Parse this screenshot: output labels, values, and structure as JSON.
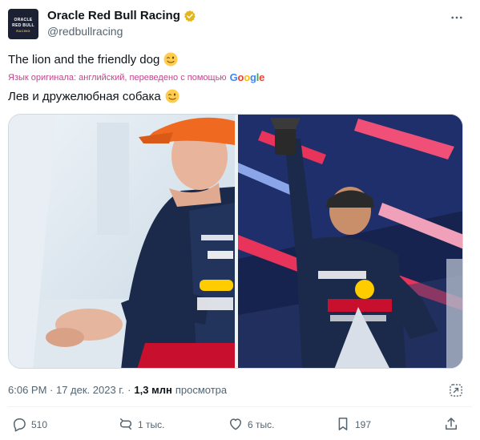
{
  "tweet": {
    "author": {
      "display_name": "Oracle Red Bull Racing",
      "handle": "@redbullracing",
      "verified_color": "#e2b719",
      "avatar_lines": [
        "ORACLE",
        "RED BULL",
        "RACING"
      ]
    },
    "text_original": "The lion and the friendly dog",
    "translation_note": {
      "prefix": "Язык оригинала: английский, переведено с помощью",
      "provider": "Google"
    },
    "text_translated": "Лев и дружелюбная собака",
    "emoji": "winking-face",
    "media": [
      {
        "alt": "driver-in-orange-cap-smiling"
      },
      {
        "alt": "driver-raising-trophy-on-podium"
      }
    ],
    "timestamp": "6:06 PM · 17 дек. 2023 г.",
    "separator": "·",
    "views_count": "1,3 млн",
    "views_label": "просмотра"
  },
  "actions": {
    "replies": "510",
    "reposts": "1 тыс.",
    "likes": "6 тыс.",
    "bookmarks": "197"
  },
  "colors": {
    "text_primary": "#0f1419",
    "text_secondary": "#536471",
    "translate": "#8b3dff"
  }
}
